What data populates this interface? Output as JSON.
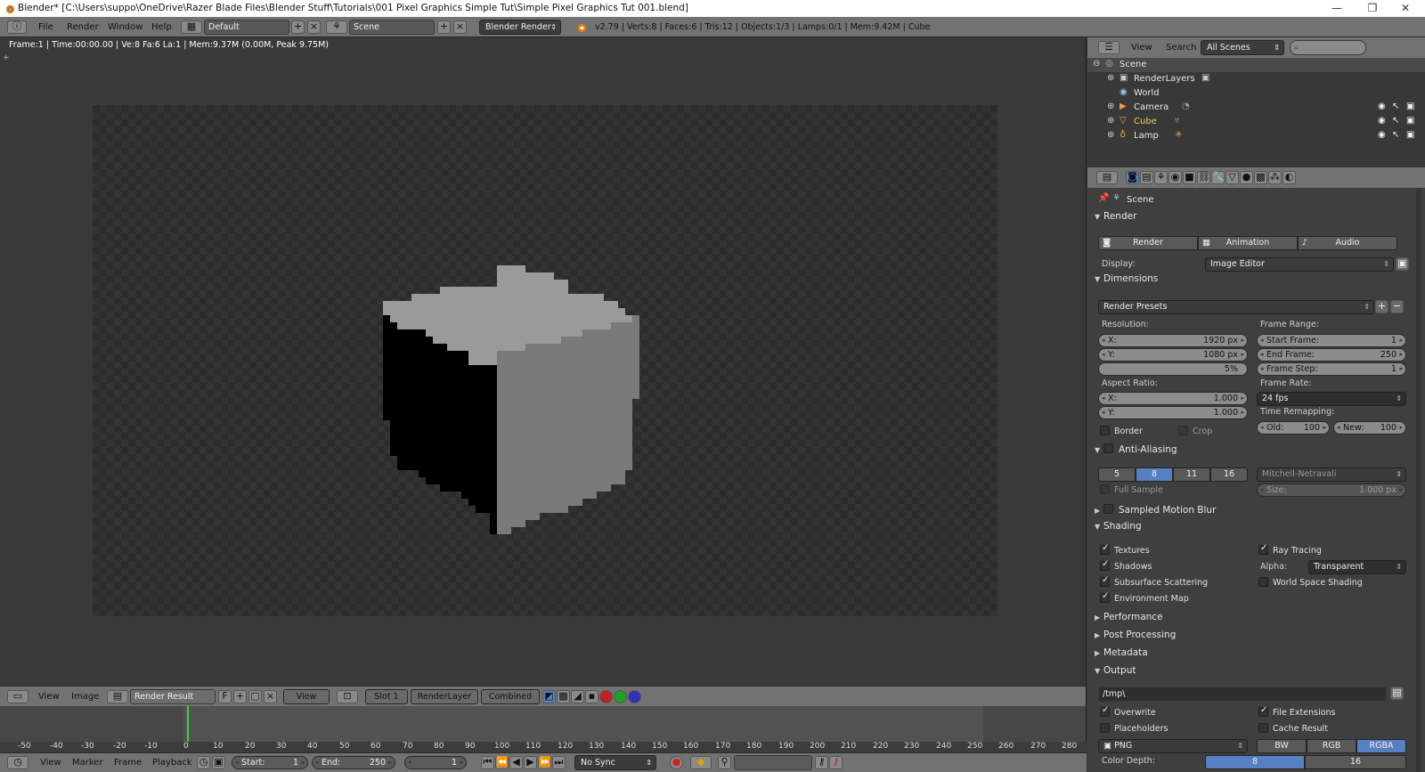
{
  "window": {
    "title": "Blender* [C:\\Users\\suppo\\OneDrive\\Razer Blade Files\\Blender Stuff\\Tutorials\\001 Pixel Graphics Simple Tut\\Simple Pixel Graphics Tut 001.blend]",
    "min": "—",
    "max": "❐",
    "close": "✕"
  },
  "info_header": {
    "menus": [
      "File",
      "Render",
      "Window",
      "Help"
    ],
    "layout": "Default",
    "scene": "Scene",
    "engine": "Blender Render",
    "stats": "v2.79 | Verts:8 | Faces:6 | Tris:12 | Objects:1/3 | Lamps:0/1 | Mem:9.42M | Cube"
  },
  "image_editor": {
    "frame_info": "Frame:1 | Time:00:00.00 | Ve:8 Fa:6 La:1 | Mem:9.37M (0.00M, Peak 9.75M)",
    "menus": [
      "View",
      "Image"
    ],
    "image_name": "Render Result",
    "fake_user": "F",
    "view_menu": "View",
    "slot": "Slot 1",
    "layer": "RenderLayer",
    "pass": "Combined"
  },
  "outliner": {
    "menus": [
      "View",
      "Search"
    ],
    "display": "All Scenes",
    "search_placeholder": "",
    "items": [
      {
        "label": "Scene"
      },
      {
        "label": "RenderLayers"
      },
      {
        "label": "World"
      },
      {
        "label": "Camera"
      },
      {
        "label": "Cube"
      },
      {
        "label": "Lamp"
      }
    ]
  },
  "properties": {
    "context": "Scene",
    "render": {
      "title": "Render",
      "buttons": [
        "Render",
        "Animation",
        "Audio"
      ],
      "display_label": "Display:",
      "display_value": "Image Editor"
    },
    "dimensions": {
      "title": "Dimensions",
      "presets": "Render Presets",
      "resolution_label": "Resolution:",
      "res_x_label": "X:",
      "res_x": "1920 px",
      "res_y_label": "Y:",
      "res_y": "1080 px",
      "res_pct": "5%",
      "frame_range_label": "Frame Range:",
      "start_label": "Start Frame:",
      "start": "1",
      "end_label": "End Frame:",
      "end": "250",
      "step_label": "Frame Step:",
      "step": "1",
      "aspect_label": "Aspect Ratio:",
      "asp_x_label": "X:",
      "asp_x": "1.000",
      "asp_y_label": "Y:",
      "asp_y": "1.000",
      "frame_rate_label": "Frame Rate:",
      "frame_rate": "24 fps",
      "time_remap_label": "Time Remapping:",
      "old_label": "Old:",
      "old": "100",
      "new_label": "New:",
      "new": "100",
      "border": "Border",
      "crop": "Crop"
    },
    "antialiasing": {
      "title": "Anti-Aliasing",
      "samples": [
        "5",
        "8",
        "11",
        "16"
      ],
      "selected": "8",
      "filter": "Mitchell-Netravali",
      "full_sample": "Full Sample",
      "size_label": "Size:",
      "size": "1.000 px"
    },
    "motion_blur": {
      "title": "Sampled Motion Blur"
    },
    "shading": {
      "title": "Shading",
      "textures": "Textures",
      "shadows": "Shadows",
      "sss": "Subsurface Scattering",
      "envmap": "Environment Map",
      "raytracing": "Ray Tracing",
      "alpha_label": "Alpha:",
      "alpha": "Transparent",
      "world_space": "World Space Shading"
    },
    "collapsed_panels": [
      "Performance",
      "Post Processing",
      "Metadata"
    ],
    "output": {
      "title": "Output",
      "path": "/tmp\\",
      "overwrite": "Overwrite",
      "placeholders": "Placeholders",
      "file_extensions": "File Extensions",
      "cache_result": "Cache Result",
      "format": "PNG",
      "color_modes": [
        "BW",
        "RGB",
        "RGBA"
      ],
      "color_mode_selected": "RGBA",
      "color_depth_label": "Color Depth:",
      "depths": [
        "8",
        "16"
      ]
    }
  },
  "timeline": {
    "ticks": [
      "-50",
      "-40",
      "-30",
      "-20",
      "-10",
      "0",
      "10",
      "20",
      "30",
      "40",
      "50",
      "60",
      "70",
      "80",
      "90",
      "100",
      "110",
      "120",
      "130",
      "140",
      "150",
      "160",
      "170",
      "180",
      "190",
      "200",
      "210",
      "220",
      "230",
      "240",
      "250",
      "260",
      "270",
      "280"
    ],
    "menus": [
      "View",
      "Marker",
      "Frame",
      "Playback"
    ],
    "start_label": "Start:",
    "start": "1",
    "end_label": "End:",
    "end": "250",
    "current": "1",
    "sync": "No Sync"
  },
  "colors": {
    "accent_blue": "#5680c2",
    "header_gray": "#727272",
    "playhead_green": "#39d639"
  }
}
